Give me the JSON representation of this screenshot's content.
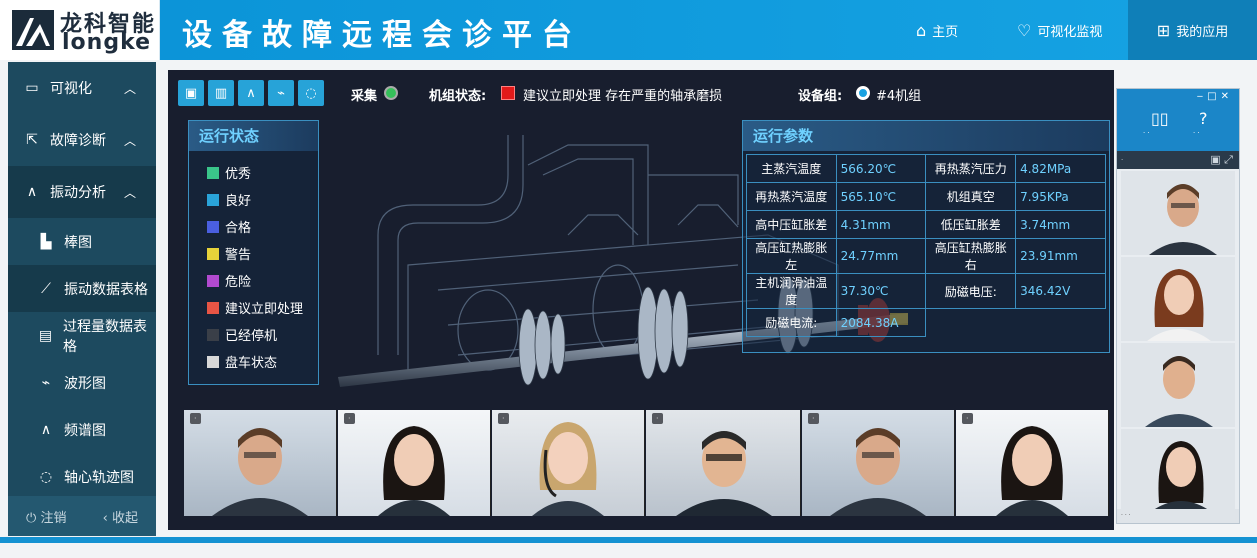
{
  "header": {
    "logo_cn": "龙科智能",
    "logo_en": "longke",
    "title": "设备故障远程会诊平台",
    "nav": [
      {
        "label": "主页",
        "icon": "home-icon"
      },
      {
        "label": "可视化监视",
        "icon": "stethoscope-icon"
      },
      {
        "label": "我的应用",
        "icon": "apps-icon"
      }
    ]
  },
  "sidebar": {
    "items": [
      {
        "label": "可视化",
        "icon": "monitor-icon"
      },
      {
        "label": "故障诊断",
        "icon": "diagnosis-icon"
      },
      {
        "label": "振动分析",
        "icon": "wave-icon"
      }
    ],
    "sub_items": [
      {
        "label": "棒图",
        "icon": "bar-chart-icon"
      },
      {
        "label": "振动数据表格",
        "icon": "line-chart-icon"
      },
      {
        "label": "过程量数据表格",
        "icon": "table-icon"
      },
      {
        "label": "波形图",
        "icon": "waveform-icon"
      },
      {
        "label": "频谱图",
        "icon": "spectrum-icon"
      },
      {
        "label": "轴心轨迹图",
        "icon": "orbit-icon"
      }
    ],
    "footer": {
      "logout": "注销",
      "collapse": "收起"
    }
  },
  "toolbar": {
    "collect_label": "采集",
    "unit_status_label": "机组状态:",
    "unit_status_text": "建议立即处理 存在严重的轴承磨损",
    "device_group_label": "设备组:",
    "device_group_value": "#4机组"
  },
  "status_panel": {
    "title": "运行状态",
    "items": [
      {
        "label": "优秀",
        "color": "#3ac58a"
      },
      {
        "label": "良好",
        "color": "#2aa3d8"
      },
      {
        "label": "合格",
        "color": "#4a5fe0"
      },
      {
        "label": "警告",
        "color": "#e6d23a"
      },
      {
        "label": "危险",
        "color": "#b24ad0"
      },
      {
        "label": "建议立即处理",
        "color": "#e85545"
      },
      {
        "label": "已经停机",
        "color": "#3a3f48"
      },
      {
        "label": "盘车状态",
        "color": "#d8d8d8"
      }
    ]
  },
  "params_panel": {
    "title": "运行参数",
    "rows": [
      {
        "k1": "主蒸汽温度",
        "v1": "566.20℃",
        "k2": "再热蒸汽压力",
        "v2": "4.82MPa"
      },
      {
        "k1": "再热蒸汽温度",
        "v1": "565.10℃",
        "k2": "机组真空",
        "v2": "7.95KPa"
      },
      {
        "k1": "高中压缸胀差",
        "v1": "4.31mm",
        "k2": "低压缸胀差",
        "v2": "3.74mm"
      },
      {
        "k1": "高压缸热膨胀左",
        "v1": "24.77mm",
        "k2": "高压缸热膨胀右",
        "v2": "23.91mm"
      },
      {
        "k1": "主机润滑油温度",
        "v1": "37.30℃",
        "k2": "励磁电压:",
        "v2": "346.42V"
      },
      {
        "k1": "励磁电流:",
        "v1": "2084.38A"
      }
    ]
  },
  "colors": {
    "accent": "#1592d2",
    "sidebar": "#1d4a5f",
    "panel_bg": "#181e2e",
    "status_red": "#e21a1a",
    "collect_green": "#35c05a"
  }
}
